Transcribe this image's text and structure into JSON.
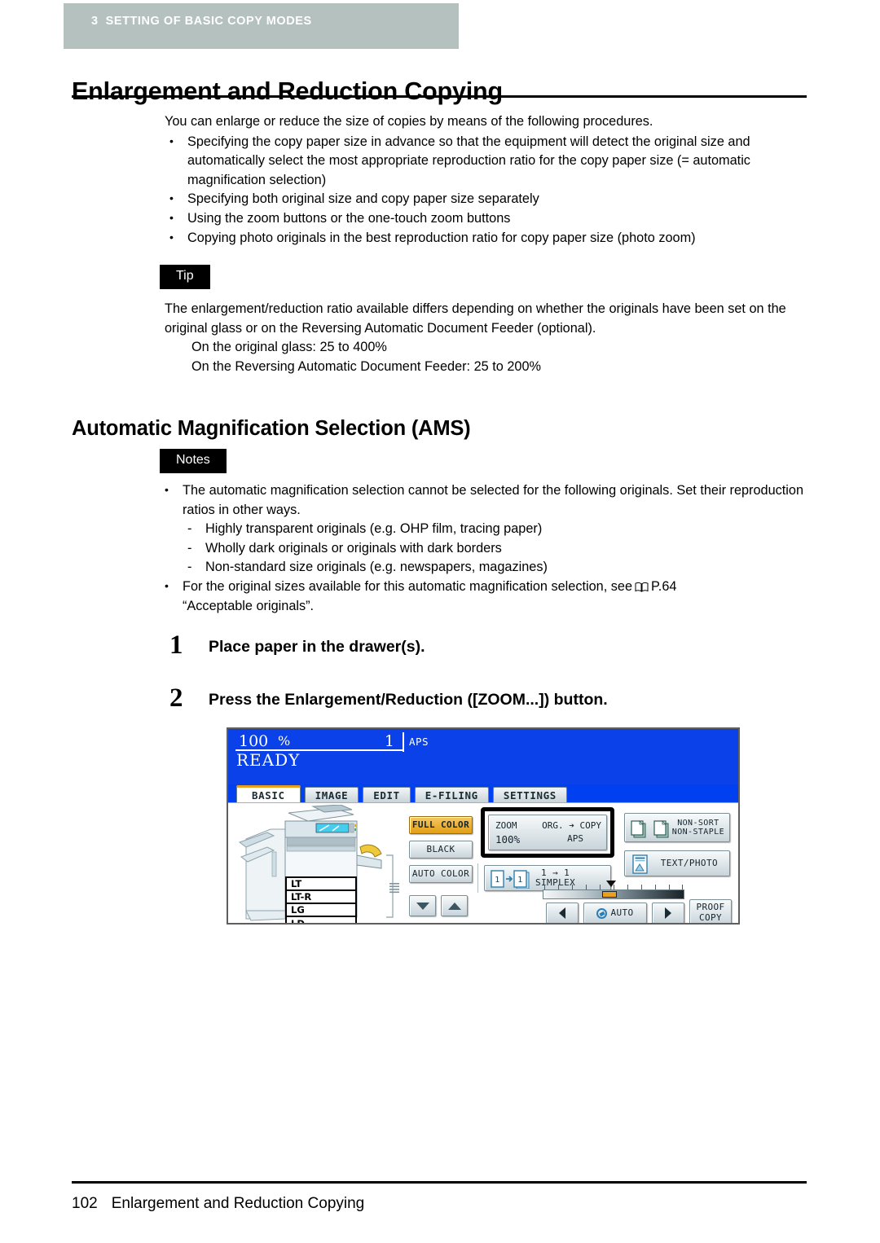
{
  "header": {
    "chapter_number": "3",
    "chapter_title": "SETTING OF BASIC COPY MODES",
    "band_color": "#b5c1bf"
  },
  "page_title": "Enlargement and Reduction Copying",
  "intro": {
    "lead": "You can enlarge or reduce the size of copies by means of the following procedures.",
    "bullets": [
      "Specifying the copy paper size in advance so that the equipment will detect the original size and automatically select the most appropriate reproduction ratio for the copy paper size (= automatic magnification selection)",
      "Specifying both original size and copy paper size separately",
      "Using the zoom buttons or the one-touch zoom buttons",
      "Copying photo originals in the best reproduction ratio for copy paper size (photo zoom)"
    ]
  },
  "tip": {
    "label": "Tip",
    "paragraph": "The enlargement/reduction ratio available differs depending on whether the originals have been set on the original glass or on the Reversing Automatic Document Feeder (optional).",
    "lines": [
      "On the original glass: 25 to 400%",
      "On the Reversing Automatic Document Feeder: 25 to 200%"
    ]
  },
  "section": {
    "title": "Automatic Magnification Selection (AMS)",
    "notes_label": "Notes",
    "note1": "The automatic magnification selection cannot be selected for the following originals. Set their reproduction ratios in other ways.",
    "sub_notes": [
      "Highly transparent originals (e.g. OHP film, tracing paper)",
      "Wholly dark originals or originals with dark borders",
      "Non-standard size originals (e.g. newspapers, magazines)"
    ],
    "note2_prefix": "For the original sizes available for this automatic magnification selection, see",
    "note2_ref": "P.64",
    "note2_suffix": "“Acceptable originals”."
  },
  "steps": [
    {
      "number": "1",
      "text": "Place paper in the drawer(s)."
    },
    {
      "number": "2",
      "text": "Press the Enlargement/Reduction ([ZOOM...]) button."
    }
  ],
  "copier_panel": {
    "status": {
      "ratio": "100",
      "percent": "%",
      "copies": "1",
      "paper_mode": "APS",
      "ready": "READY"
    },
    "tabs": [
      {
        "label": "BASIC",
        "active": true
      },
      {
        "label": "IMAGE",
        "active": false
      },
      {
        "label": "EDIT",
        "active": false
      },
      {
        "label": "E-FILING",
        "active": false
      },
      {
        "label": "SETTINGS",
        "active": false
      }
    ],
    "drawers": [
      "LT",
      "LT-R",
      "LG",
      "LD"
    ],
    "color_modes": [
      {
        "label": "FULL COLOR",
        "selected": true
      },
      {
        "label": "BLACK",
        "selected": false
      },
      {
        "label": "AUTO COLOR",
        "selected": false
      }
    ],
    "zoom_button": {
      "zoom_label": "ZOOM",
      "zoom_value": "100%",
      "org_copy_label": "ORG. ➔ COPY",
      "org_copy_value": "APS",
      "highlighted": true
    },
    "duplex_button": {
      "mode": "1 → 1",
      "label": "SIMPLEX"
    },
    "finishing_button": {
      "line1": "NON-SORT",
      "line2": "NON-STAPLE"
    },
    "original_mode_button": "TEXT/PHOTO",
    "density": {
      "auto_label": "AUTO",
      "left_arrow": "◀",
      "right_arrow": "▶",
      "marker_position_percent": 45
    },
    "proof_button": {
      "line1": "PROOF",
      "line2": "COPY"
    },
    "scroll_down": "▼",
    "scroll_up": "▲"
  },
  "footer": {
    "page_number": "102",
    "title": "Enlargement and Reduction Copying"
  }
}
